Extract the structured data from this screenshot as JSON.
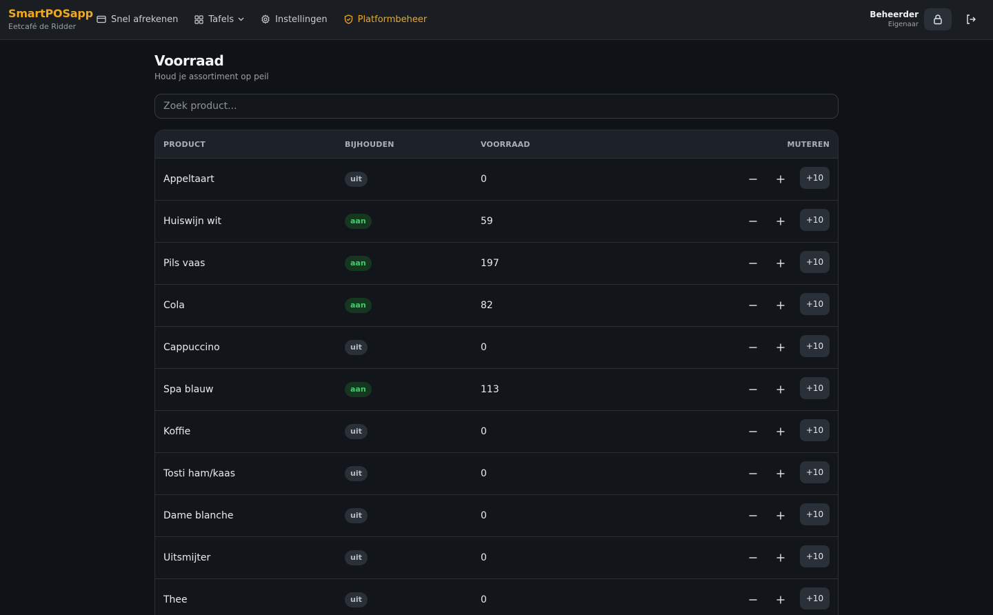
{
  "brand": {
    "name": "SmartPOSapp",
    "subtitle": "Eetcafé de Ridder"
  },
  "nav": [
    {
      "label": "Snel afrekenen",
      "icon": "card-icon"
    },
    {
      "label": "Tafels",
      "icon": "grid-icon"
    },
    {
      "label": "Instellingen",
      "icon": "gear-icon"
    },
    {
      "label": "Platformbeheer",
      "icon": "shield-icon",
      "active": true
    }
  ],
  "user": {
    "name": "Beheerder",
    "role": "Eigenaar"
  },
  "page": {
    "title": "Voorraad",
    "subtitle": "Houd je assortiment op peil"
  },
  "search": {
    "placeholder": "Zoek product..."
  },
  "table": {
    "headers": {
      "product": "PRODUCT",
      "track": "BIJHOUDEN",
      "stock": "VOORRAAD",
      "mutate": "MUTEREN"
    },
    "plus10_label": "+10",
    "rows": [
      {
        "product": "Appeltaart",
        "track": "uit",
        "stock": "0"
      },
      {
        "product": "Huiswijn wit",
        "track": "aan",
        "stock": "59"
      },
      {
        "product": "Pils vaas",
        "track": "aan",
        "stock": "197"
      },
      {
        "product": "Cola",
        "track": "aan",
        "stock": "82"
      },
      {
        "product": "Cappuccino",
        "track": "uit",
        "stock": "0"
      },
      {
        "product": "Spa blauw",
        "track": "aan",
        "stock": "113"
      },
      {
        "product": "Koffie",
        "track": "uit",
        "stock": "0"
      },
      {
        "product": "Tosti ham/kaas",
        "track": "uit",
        "stock": "0"
      },
      {
        "product": "Dame blanche",
        "track": "uit",
        "stock": "0"
      },
      {
        "product": "Uitsmijter",
        "track": "uit",
        "stock": "0"
      },
      {
        "product": "Thee",
        "track": "uit",
        "stock": "0"
      }
    ]
  },
  "colors": {
    "accent": "#f0a81c",
    "on_badge": "#3ccf6a",
    "background": "#0f1216"
  }
}
